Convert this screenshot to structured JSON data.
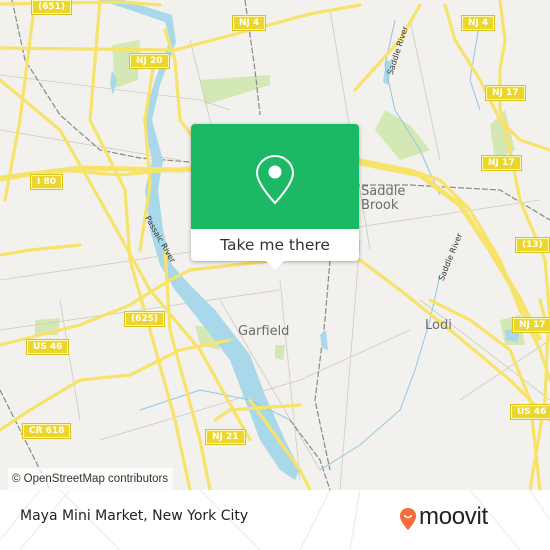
{
  "map": {
    "attribution": "© OpenStreetMap contributors",
    "shields": [
      {
        "id": "651",
        "label": "(651)"
      },
      {
        "id": "nj4-left",
        "label": "NJ 4"
      },
      {
        "id": "nj4-right",
        "label": "NJ 4"
      },
      {
        "id": "nj20",
        "label": "NJ 20"
      },
      {
        "id": "nj17-top",
        "label": "NJ 17"
      },
      {
        "id": "nj17-mid",
        "label": "NJ 17"
      },
      {
        "id": "i80",
        "label": "I 80"
      },
      {
        "id": "13",
        "label": "(13)"
      },
      {
        "id": "625",
        "label": "(625)"
      },
      {
        "id": "us46-left",
        "label": "US 46"
      },
      {
        "id": "nj17-low",
        "label": "NJ 17"
      },
      {
        "id": "us46-right",
        "label": "US 46"
      },
      {
        "id": "cr618",
        "label": "CR 618"
      },
      {
        "id": "nj21",
        "label": "NJ 21"
      }
    ],
    "places": {
      "saddle_brook_line1": "Saddle",
      "saddle_brook_line2": "Brook",
      "garfield": "Garfield",
      "lodi": "Lodi"
    },
    "rivers": {
      "saddle_river_north": "Saddle River",
      "saddle_river_south": "Saddle River",
      "passaic_river": "Passaic River"
    },
    "colors": {
      "land": "#f2f1ed",
      "road": "#f7e36a",
      "water": "#a8d8ea",
      "park": "#d4e8b5",
      "accent": "#1db866",
      "brand": "#f46b3c"
    }
  },
  "popup": {
    "icon": "location-pin-icon",
    "button_label": "Take me there"
  },
  "footer": {
    "title": "Maya Mini Market, New York City",
    "logo_text": "moovit",
    "logo_icon": "moovit-pin-icon"
  }
}
